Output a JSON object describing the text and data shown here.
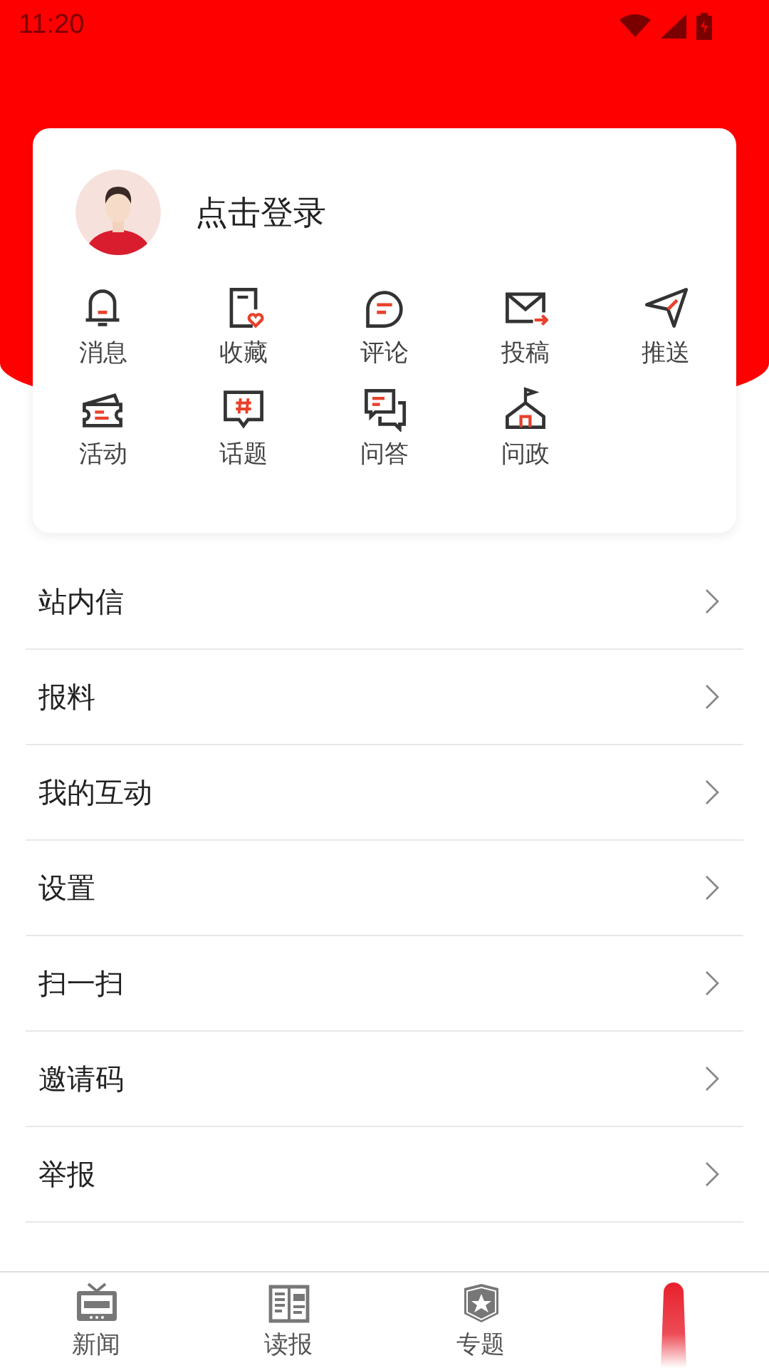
{
  "status_bar": {
    "time": "11:20"
  },
  "profile": {
    "login_text": "点击登录"
  },
  "shortcuts": [
    {
      "label": "消息",
      "kind": "bell"
    },
    {
      "label": "收藏",
      "kind": "favorite"
    },
    {
      "label": "评论",
      "kind": "comment"
    },
    {
      "label": "投稿",
      "kind": "mail"
    },
    {
      "label": "推送",
      "kind": "send"
    },
    {
      "label": "活动",
      "kind": "ticket"
    },
    {
      "label": "话题",
      "kind": "topic"
    },
    {
      "label": "问答",
      "kind": "qa"
    },
    {
      "label": "问政",
      "kind": "hall"
    }
  ],
  "menu": [
    {
      "label": "站内信"
    },
    {
      "label": "报料"
    },
    {
      "label": "我的互动"
    },
    {
      "label": "设置"
    },
    {
      "label": "扫一扫"
    },
    {
      "label": "邀请码"
    },
    {
      "label": "举报"
    }
  ],
  "bottom_nav": [
    {
      "label": "新闻",
      "kind": "tv"
    },
    {
      "label": "读报",
      "kind": "paper"
    },
    {
      "label": "专题",
      "kind": "badge"
    },
    {
      "kind": "blob"
    }
  ]
}
